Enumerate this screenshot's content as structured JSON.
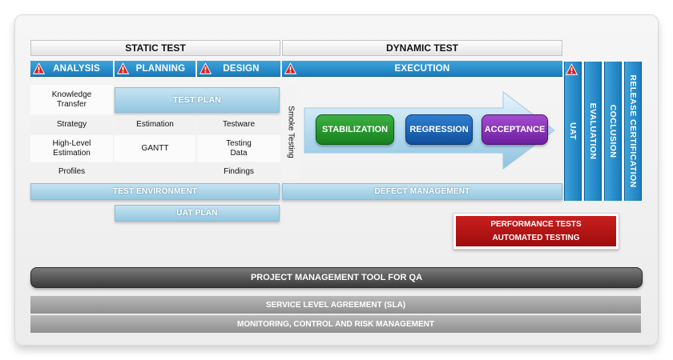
{
  "headers": {
    "static": "STATIC TEST",
    "dynamic": "DYNAMIC TEST"
  },
  "phases": {
    "analysis": "ANALYSIS",
    "planning": "PLANNING",
    "design": "DESIGN",
    "execution": "EXECUTION"
  },
  "vertical_phases": {
    "uat": "UAT",
    "evaluation": "EVALUATION",
    "coclusion": "COCLUSION",
    "release": "RELEASE CERTIFICATION"
  },
  "analysis_items": {
    "knowledge_transfer": "Knowledge\nTransfer",
    "strategy": "Strategy",
    "high_level_estimation": "High-Level\nEstimation",
    "profiles": "Profiles"
  },
  "planning_items": {
    "test_plan": "TEST PLAN",
    "estimation": "Estimation",
    "gantt": "GANTT"
  },
  "design_items": {
    "testware": "Testware",
    "testing_data": "Testing\nData",
    "findings": "Findings"
  },
  "smoke_testing": "Smoke Testing",
  "execution_steps": {
    "stabilization": "STABILIZATION",
    "regression": "REGRESSION",
    "acceptance": "ACCEPTANCE"
  },
  "bars": {
    "test_environment": "TEST ENVIRONMENT",
    "defect_management": "DEFECT MANAGEMENT",
    "uat_plan": "UAT PLAN"
  },
  "red_box": {
    "line1": "PERFORMANCE TESTS",
    "line2": "AUTOMATED TESTING"
  },
  "footer": {
    "pm_tool": "PROJECT MANAGEMENT TOOL FOR QA",
    "sla": "SERVICE LEVEL AGREEMENT (SLA)",
    "monitoring": "MONITORING, CONTROL AND RISK MANAGEMENT"
  },
  "colors": {
    "phase_blue": "#1a7cbd",
    "light_blue": "#a8d3e9",
    "green": "#17801f",
    "dark_blue": "#114f9c",
    "purple": "#6d1f9d",
    "red": "#b21414",
    "warning_red": "#d62020"
  }
}
